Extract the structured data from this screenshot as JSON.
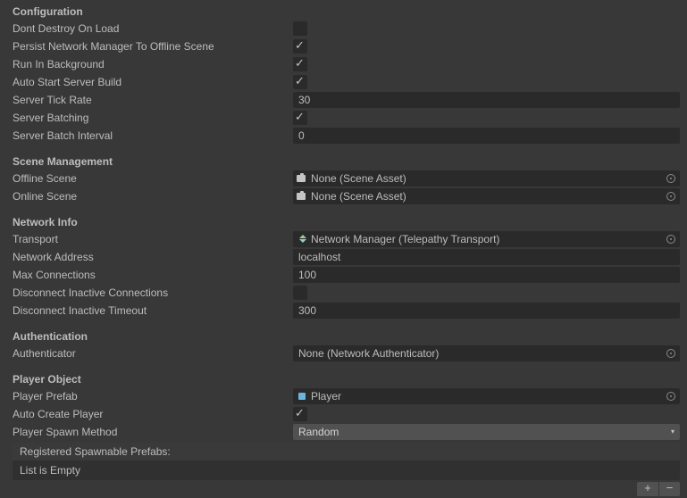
{
  "sections": {
    "configuration": {
      "title": "Configuration",
      "dontDestroy": {
        "label": "Dont Destroy On Load",
        "checked": false
      },
      "persistNM": {
        "label": "Persist Network Manager To Offline Scene",
        "checked": true
      },
      "runInBg": {
        "label": "Run In Background",
        "checked": true
      },
      "autoStart": {
        "label": "Auto Start Server Build",
        "checked": true
      },
      "tickRate": {
        "label": "Server Tick Rate",
        "value": "30"
      },
      "batching": {
        "label": "Server Batching",
        "checked": true
      },
      "batchInterval": {
        "label": "Server Batch Interval",
        "value": "0"
      }
    },
    "sceneMgmt": {
      "title": "Scene Management",
      "offline": {
        "label": "Offline Scene",
        "value": "None (Scene Asset)"
      },
      "online": {
        "label": "Online Scene",
        "value": "None (Scene Asset)"
      }
    },
    "networkInfo": {
      "title": "Network Info",
      "transport": {
        "label": "Transport",
        "value": "Network Manager (Telepathy Transport)"
      },
      "address": {
        "label": "Network Address",
        "value": "localhost"
      },
      "maxConn": {
        "label": "Max Connections",
        "value": "100"
      },
      "discInactive": {
        "label": "Disconnect Inactive Connections",
        "checked": false
      },
      "discTimeout": {
        "label": "Disconnect Inactive Timeout",
        "value": "300"
      }
    },
    "auth": {
      "title": "Authentication",
      "authenticator": {
        "label": "Authenticator",
        "value": "None (Network Authenticator)"
      }
    },
    "playerObj": {
      "title": "Player Object",
      "prefab": {
        "label": "Player Prefab",
        "value": "Player"
      },
      "autoCreate": {
        "label": "Auto Create Player",
        "checked": true
      },
      "spawnMethod": {
        "label": "Player Spawn Method",
        "value": "Random"
      },
      "listTitle": "Registered Spawnable Prefabs:",
      "listEmpty": "List is Empty"
    }
  },
  "buttons": {
    "plus": "+",
    "minus": "−"
  }
}
